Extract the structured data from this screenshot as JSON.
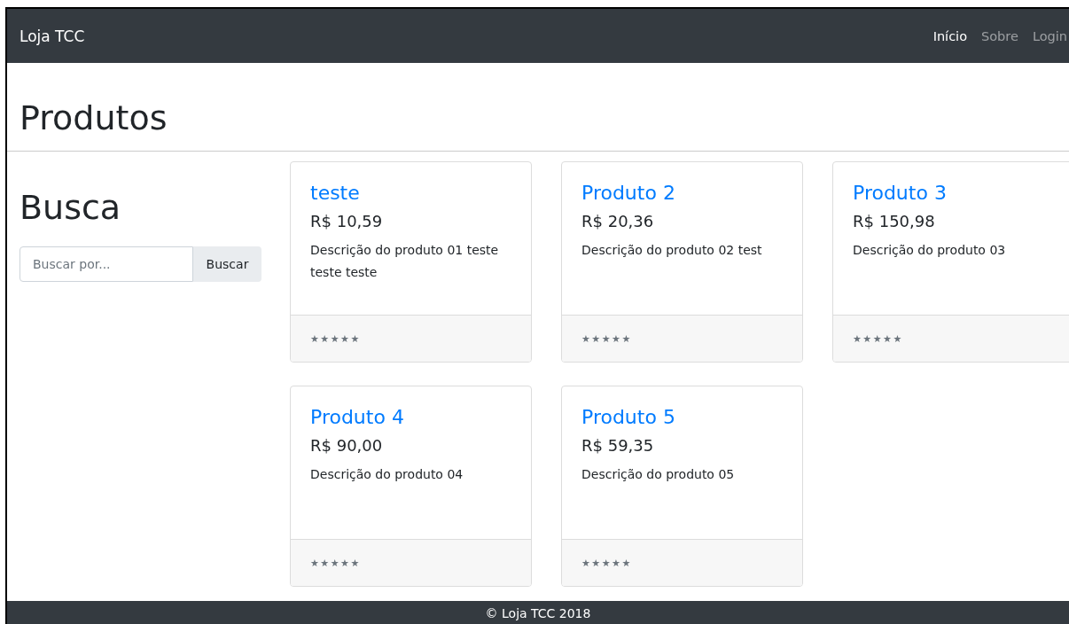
{
  "navbar": {
    "brand": "Loja TCC",
    "links": [
      {
        "label": "Início",
        "selected": true
      },
      {
        "label": "Sobre",
        "selected": false
      },
      {
        "label": "Login",
        "selected": false
      }
    ]
  },
  "heading": "Produtos",
  "search": {
    "title": "Busca",
    "placeholder": "Buscar por...",
    "button": "Buscar"
  },
  "products": [
    {
      "name": "teste",
      "price": "R$ 10,59",
      "description": "Descrição do produto 01 teste teste teste",
      "rating": "★ ★ ★ ★ ★"
    },
    {
      "name": "Produto 2",
      "price": "R$ 20,36",
      "description": "Descrição do produto 02 test",
      "rating": "★ ★ ★ ★ ★"
    },
    {
      "name": "Produto 3",
      "price": "R$ 150,98",
      "description": "Descrição do produto 03",
      "rating": "★ ★ ★ ★ ★"
    },
    {
      "name": "Produto 4",
      "price": "R$ 90,00",
      "description": "Descrição do produto 04",
      "rating": "★ ★ ★ ★ ★"
    },
    {
      "name": "Produto 5",
      "price": "R$ 59,35",
      "description": "Descrição do produto 05",
      "rating": "★ ★ ★ ★ ★"
    }
  ],
  "footer": "© Loja TCC 2018"
}
